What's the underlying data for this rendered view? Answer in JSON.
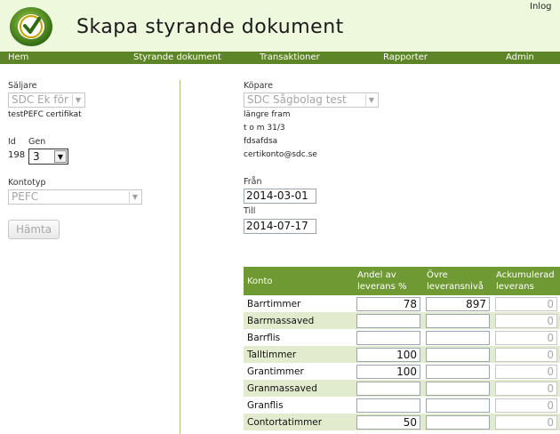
{
  "header": {
    "site_title": "Skapa styrande dokument",
    "login_text": "Inlog"
  },
  "nav": [
    "Hem",
    "Styrande dokument",
    "Transaktioner",
    "Rapporter",
    "Admin"
  ],
  "seller": {
    "label": "Säljare",
    "select_value": "SDC Ek för",
    "certificate": "testPEFC certifikat",
    "id_label": "Id",
    "id_value": "198",
    "gen_label": "Gen",
    "gen_value": "3"
  },
  "account_type": {
    "label": "Kontotyp",
    "select_value": "PEFC"
  },
  "fetch_button": "Hämta",
  "buyer": {
    "label": "Köpare",
    "select_value": "SDC Sågbolag test",
    "lines": [
      "längre fram",
      "t o m 31/3",
      "fdsafdsa",
      "certikonto@sdc.se"
    ]
  },
  "dates": {
    "from_label": "Från",
    "from_value": "2014-03-01",
    "to_label": "Till",
    "to_value": "2014-07-17"
  },
  "table": {
    "headers": [
      "Konto",
      "Andel av leverans %",
      "Övre leveransnivå",
      "Ackumulerad leverans"
    ],
    "rows": [
      {
        "konto": "Barrtimmer",
        "andel": "78",
        "ovre": "897",
        "ack": "0"
      },
      {
        "konto": "Barrmassaved",
        "andel": "",
        "ovre": "",
        "ack": "0"
      },
      {
        "konto": "Barrflis",
        "andel": "",
        "ovre": "",
        "ack": "0"
      },
      {
        "konto": "Talltimmer",
        "andel": "100",
        "ovre": "",
        "ack": "0"
      },
      {
        "konto": "Grantimmer",
        "andel": "100",
        "ovre": "",
        "ack": "0"
      },
      {
        "konto": "Granmassaved",
        "andel": "",
        "ovre": "",
        "ack": "0"
      },
      {
        "konto": "Granflis",
        "andel": "",
        "ovre": "",
        "ack": "0"
      },
      {
        "konto": "Contortatimmer",
        "andel": "50",
        "ovre": "",
        "ack": "0"
      }
    ]
  },
  "colors": {
    "nav_bg": "#5d8427",
    "header_bg": "#eef8dc",
    "table_header_bg": "#6f9a33",
    "row_alt_bg": "#e3ebcf"
  }
}
